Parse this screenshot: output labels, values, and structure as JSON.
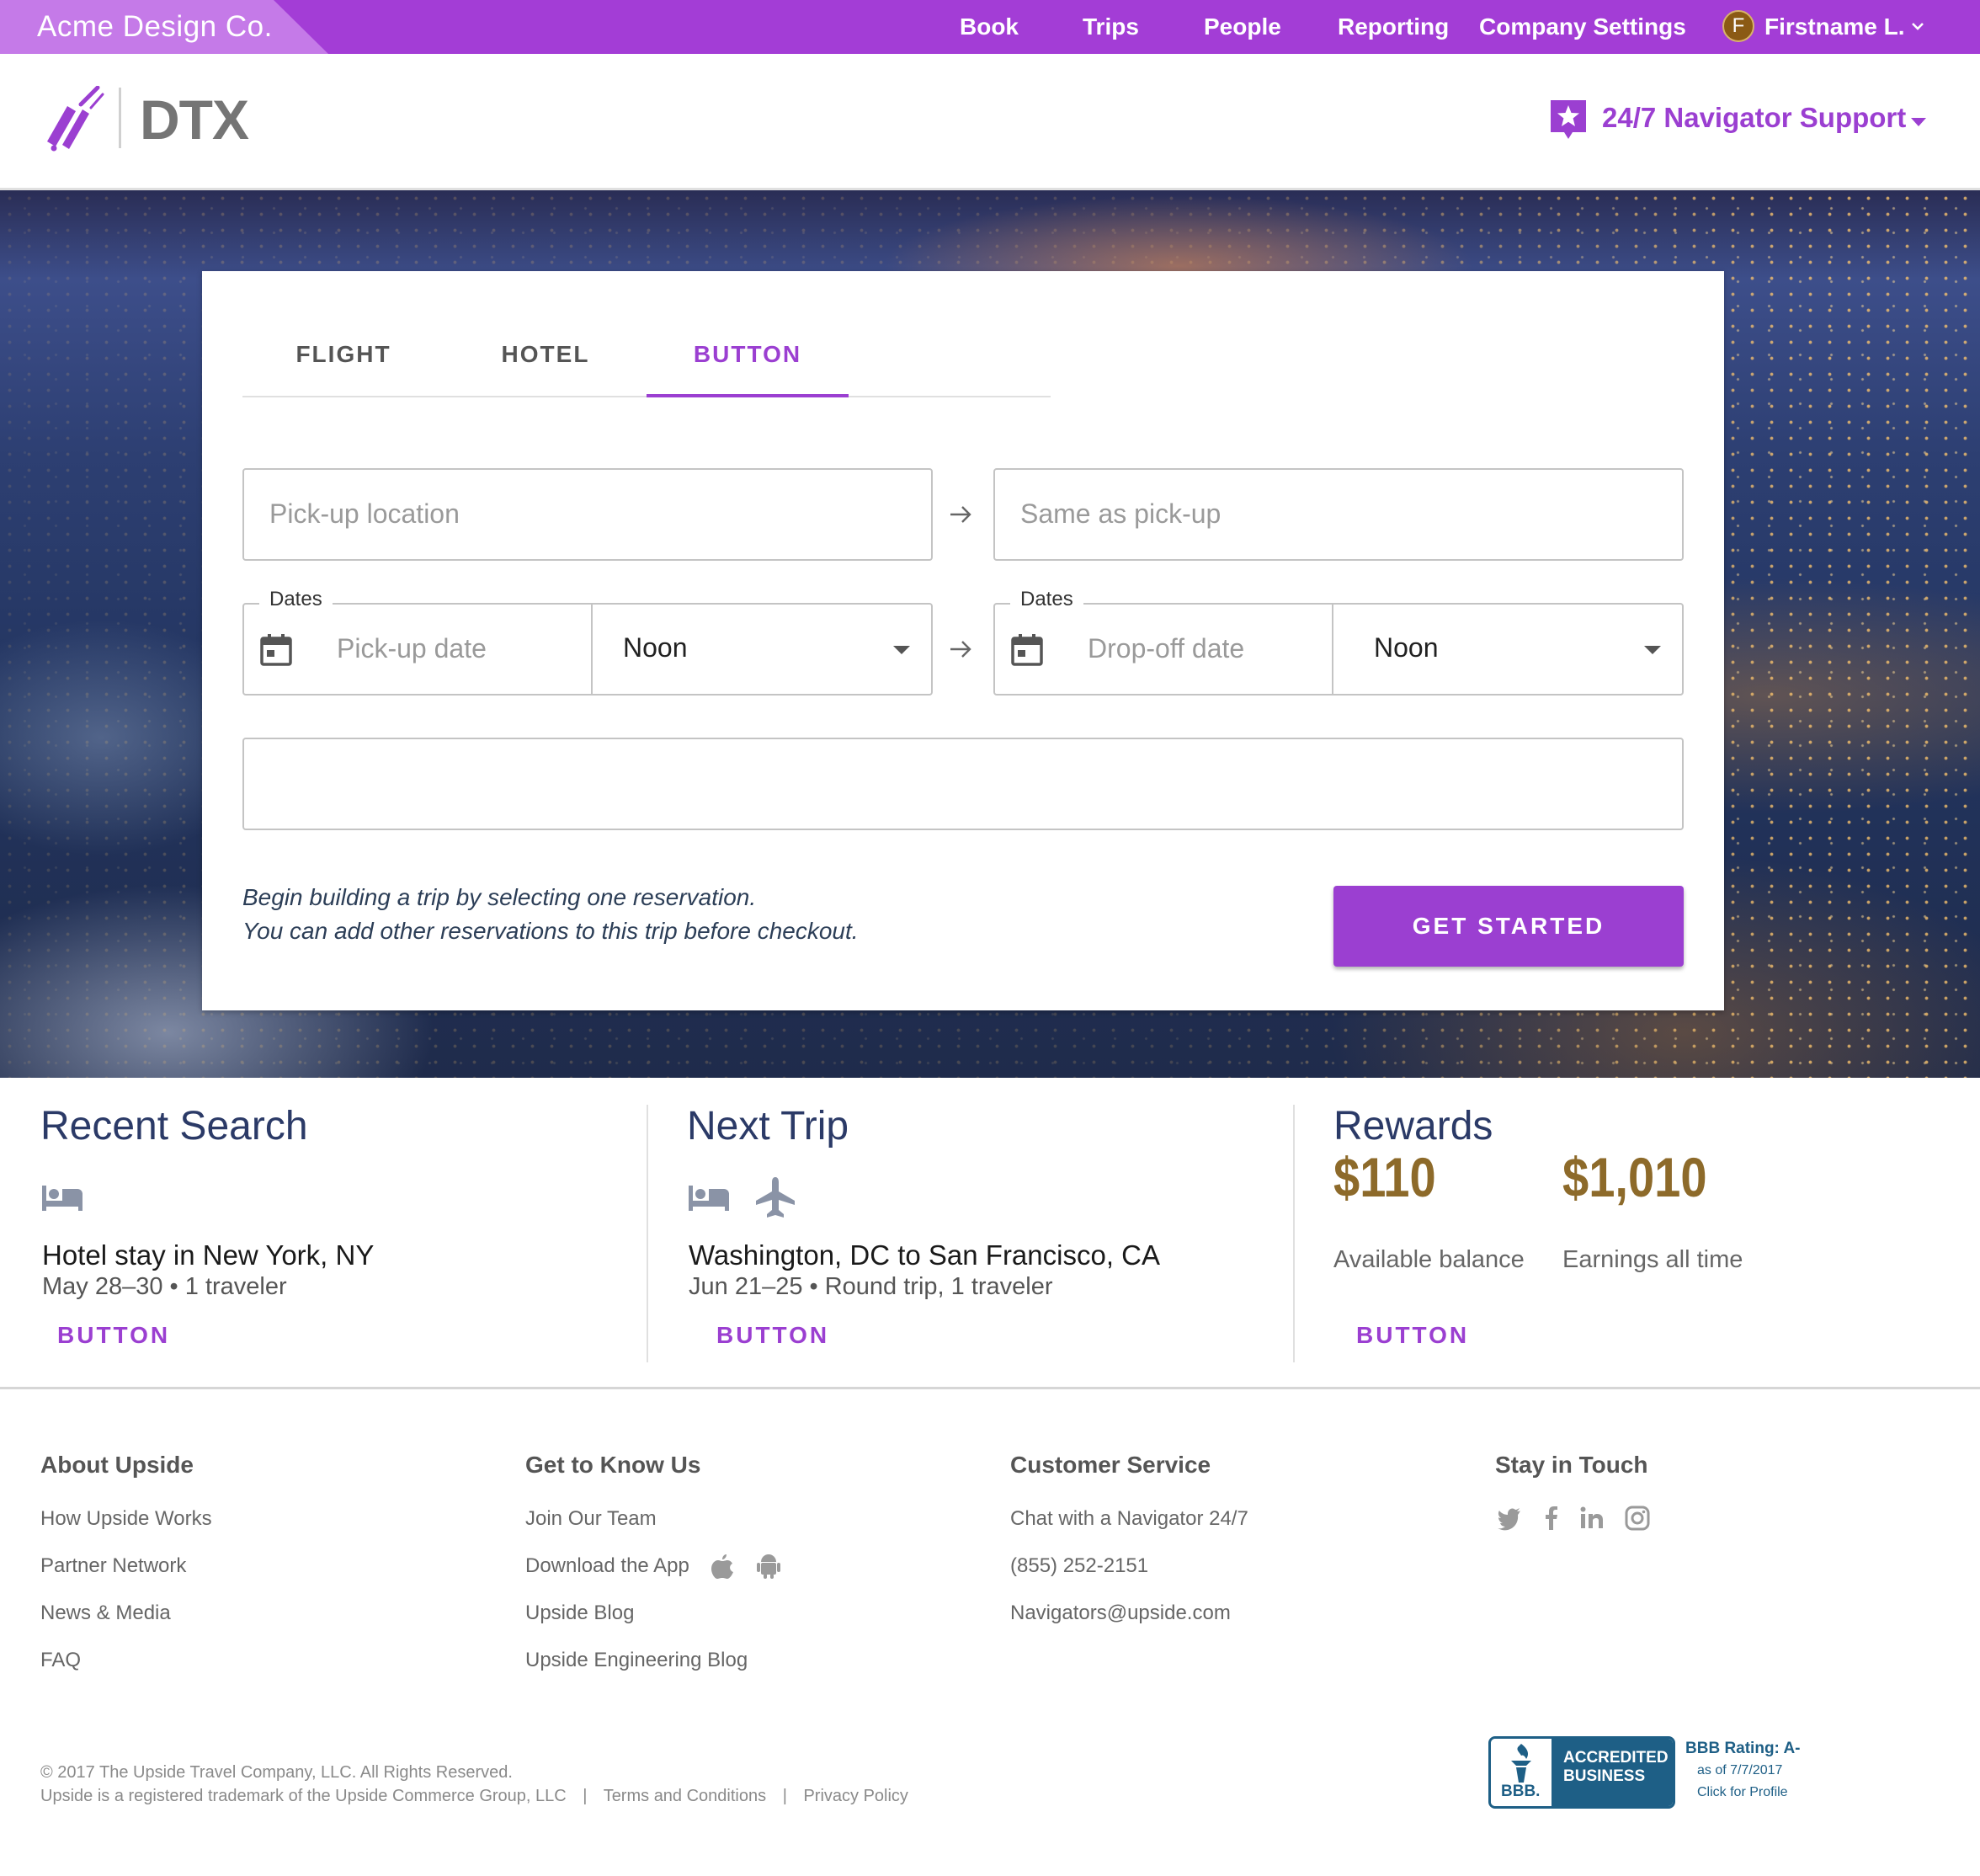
{
  "topbar": {
    "company": "Acme Design Co.",
    "nav": [
      "Book",
      "Trips",
      "People",
      "Reporting",
      "Company Settings"
    ],
    "avatar_initial": "F",
    "user_name": "Firstname L.",
    "bg_color": "#a33dd6"
  },
  "header": {
    "logo_text": "DTX",
    "support_label": "24/7 Navigator Support",
    "accent_color": "#9b3fd1"
  },
  "booking": {
    "tabs": [
      "FLIGHT",
      "HOTEL",
      "BUTTON"
    ],
    "active_tab": "BUTTON",
    "pickup_location_placeholder": "Pick-up location",
    "dropoff_location_placeholder": "Same as pick-up",
    "dates_legend_left": "Dates",
    "dates_legend_right": "Dates",
    "pickup_date_placeholder": "Pick-up date",
    "dropoff_date_placeholder": "Drop-off date",
    "pickup_time": "Noon",
    "dropoff_time": "Noon",
    "hint_line1": "Begin building a trip by selecting one reservation.",
    "hint_line2": "You can add other reservations to this trip before checkout.",
    "cta": "GET STARTED"
  },
  "recent_search": {
    "title": "Recent Search",
    "icons": [
      "hotel-icon"
    ],
    "main": "Hotel stay in New York, NY",
    "sub": "May 28–30  •  1 traveler",
    "button": "BUTTON"
  },
  "next_trip": {
    "title": "Next Trip",
    "icons": [
      "hotel-icon",
      "airplane-icon"
    ],
    "main": "Washington, DC to San Francisco, CA",
    "sub": "Jun 21–25  •  Round trip, 1 traveler",
    "button": "BUTTON"
  },
  "rewards": {
    "title": "Rewards",
    "available_amount": "$110",
    "available_label": "Available balance",
    "earnings_amount": "$1,010",
    "earnings_label": "Earnings all time",
    "button": "BUTTON",
    "amount_color": "#8d6a2a"
  },
  "footer": {
    "about": {
      "heading": "About Upside",
      "links": [
        "How Upside Works",
        "Partner Network",
        "News & Media",
        "FAQ"
      ]
    },
    "know": {
      "heading": "Get to Know Us",
      "links": [
        "Join Our Team",
        "Download the App",
        "Upside Blog",
        "Upside Engineering Blog"
      ]
    },
    "service": {
      "heading": "Customer Service",
      "links": [
        "Chat with a Navigator 24/7",
        "(855) 252-2151",
        "Navigators@upside.com"
      ]
    },
    "touch": {
      "heading": "Stay in Touch",
      "social": [
        "twitter-icon",
        "facebook-icon",
        "linkedin-icon",
        "instagram-icon"
      ]
    },
    "copyright": "© 2017 The Upside Travel Company, LLC. All Rights Reserved.",
    "trademark": "Upside is a registered trademark of the Upside Commerce Group, LLC",
    "sep": "|",
    "terms": "Terms and Conditions",
    "privacy": "Privacy Policy",
    "bbb": {
      "seal_text": "BBB.",
      "accredited_line1": "ACCREDITED",
      "accredited_line2": "BUSINESS",
      "rating": "BBB Rating: A-",
      "as_of": "as of 7/7/2017",
      "click": "Click for Profile"
    }
  }
}
